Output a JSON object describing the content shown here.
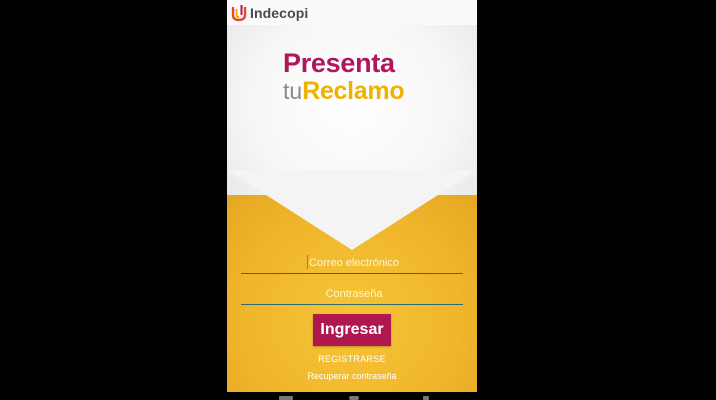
{
  "appbar": {
    "brand": "Indecopi",
    "logo_icon": "indecopi-logo-icon"
  },
  "hero": {
    "title_line1": "Presenta",
    "title_tu": "tu",
    "title_reclamo": "Reclamo"
  },
  "form": {
    "email_placeholder": "Correo electrónico",
    "password_placeholder": "Contraseña",
    "submit_label": "Ingresar",
    "register_label": "REGISTRARSE",
    "recover_label": "Recuperar contraseña"
  },
  "colors": {
    "brand_magenta": "#b0175a",
    "brand_yellow": "#f0b200",
    "button": "#b0174f"
  }
}
